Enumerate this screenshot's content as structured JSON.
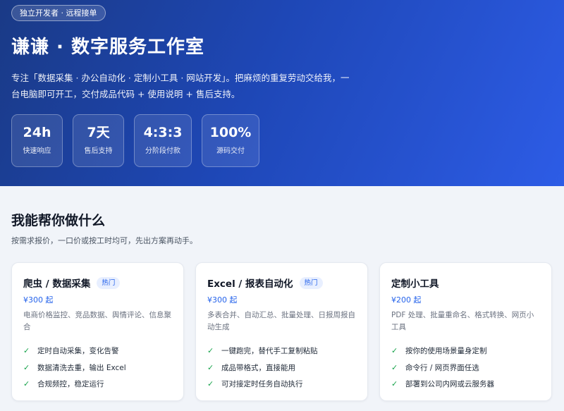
{
  "hero": {
    "badge": "独立开发者 · 远程接单",
    "title": "谦谦 · 数字服务工作室",
    "description": "专注「数据采集 · 办公自动化 · 定制小工具 · 网站开发」。把麻烦的重复劳动交给我，一台电脑即可开工，交付成品代码 + 使用说明 + 售后支持。",
    "stats": [
      {
        "value": "24h",
        "label": "快速响应"
      },
      {
        "value": "7天",
        "label": "售后支持"
      },
      {
        "value": "4:3:3",
        "label": "分阶段付款"
      },
      {
        "value": "100%",
        "label": "源码交付"
      }
    ]
  },
  "services": {
    "title": "我能帮你做什么",
    "subtitle": "按需求报价，一口价或按工时均可，先出方案再动手。",
    "cards": [
      {
        "title": "爬虫 / 数据采集",
        "tag": "热门",
        "price": "¥300 起",
        "description": "电商价格监控、竞品数据、舆情评论、信息聚合",
        "features": [
          "定时自动采集，变化告警",
          "数据清洗去重，输出 Excel",
          "合规频控，稳定运行"
        ]
      },
      {
        "title": "Excel / 报表自动化",
        "tag": "热门",
        "price": "¥300 起",
        "description": "多表合并、自动汇总、批量处理、日报周报自动生成",
        "features": [
          "一键跑完，替代手工复制粘贴",
          "成品带格式，直接能用",
          "可对接定时任务自动执行"
        ]
      },
      {
        "title": "定制小工具",
        "tag": "",
        "price": "¥200 起",
        "description": "PDF 处理、批量重命名、格式转换、网页小工具",
        "features": [
          "按你的使用场景量身定制",
          "命令行 / 网页界面任选",
          "部署到公司内网或云服务器"
        ]
      }
    ]
  },
  "icons": {
    "check": "check-icon"
  },
  "colors": {
    "accent": "#2563eb",
    "check": "#16a34a",
    "hero_start": "#1a3a86",
    "hero_end": "#2d5ce6"
  }
}
